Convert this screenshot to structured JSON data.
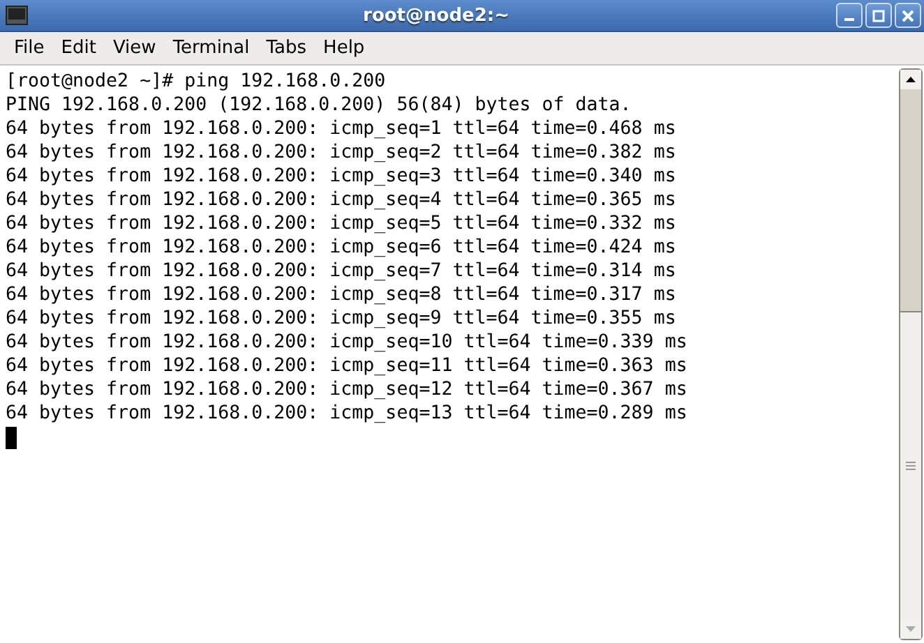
{
  "window": {
    "title": "root@node2:~"
  },
  "menu": [
    {
      "label": "File"
    },
    {
      "label": "Edit"
    },
    {
      "label": "View"
    },
    {
      "label": "Terminal"
    },
    {
      "label": "Tabs"
    },
    {
      "label": "Help"
    }
  ],
  "terminal": {
    "lines": [
      "[root@node2 ~]# ping 192.168.0.200",
      "PING 192.168.0.200 (192.168.0.200) 56(84) bytes of data.",
      "64 bytes from 192.168.0.200: icmp_seq=1 ttl=64 time=0.468 ms",
      "64 bytes from 192.168.0.200: icmp_seq=2 ttl=64 time=0.382 ms",
      "64 bytes from 192.168.0.200: icmp_seq=3 ttl=64 time=0.340 ms",
      "64 bytes from 192.168.0.200: icmp_seq=4 ttl=64 time=0.365 ms",
      "64 bytes from 192.168.0.200: icmp_seq=5 ttl=64 time=0.332 ms",
      "64 bytes from 192.168.0.200: icmp_seq=6 ttl=64 time=0.424 ms",
      "64 bytes from 192.168.0.200: icmp_seq=7 ttl=64 time=0.314 ms",
      "64 bytes from 192.168.0.200: icmp_seq=8 ttl=64 time=0.317 ms",
      "64 bytes from 192.168.0.200: icmp_seq=9 ttl=64 time=0.355 ms",
      "64 bytes from 192.168.0.200: icmp_seq=10 ttl=64 time=0.339 ms",
      "64 bytes from 192.168.0.200: icmp_seq=11 ttl=64 time=0.363 ms",
      "64 bytes from 192.168.0.200: icmp_seq=12 ttl=64 time=0.367 ms",
      "64 bytes from 192.168.0.200: icmp_seq=13 ttl=64 time=0.289 ms"
    ]
  }
}
